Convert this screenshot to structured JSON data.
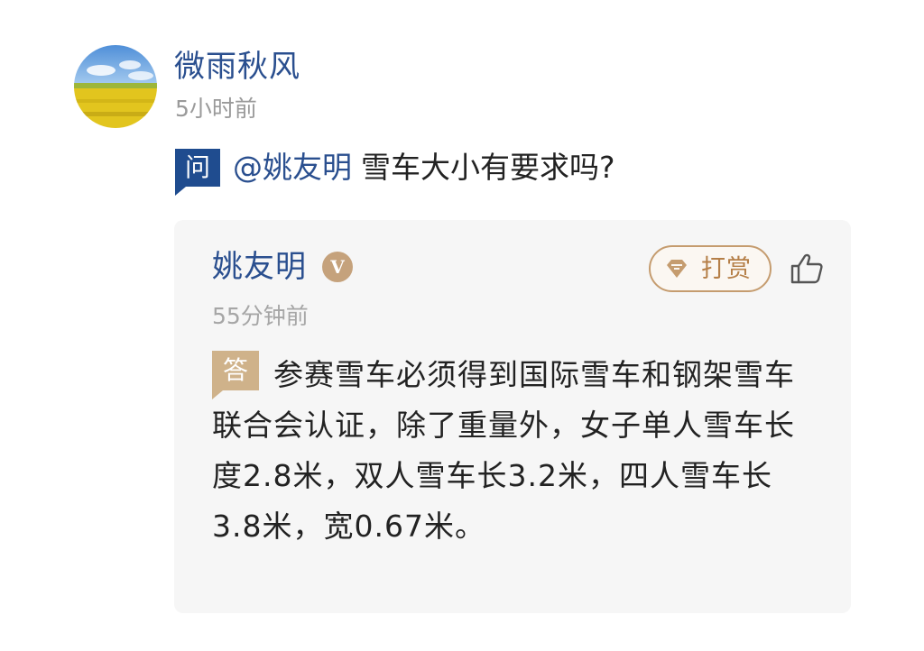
{
  "asker": {
    "name": "微雨秋风",
    "time": "5小时前",
    "avatar_icon": "avatar-rapeseed-field"
  },
  "question": {
    "badge": "问",
    "mention": "@姚友明",
    "text": "雪车大小有要求吗?"
  },
  "answer": {
    "answerer_name": "姚友明",
    "verified_badge": "V",
    "tip_label": "打赏",
    "tip_icon": "diamond-icon",
    "like_icon": "thumbs-up-icon",
    "time": "55分钟前",
    "badge": "答",
    "text": "参赛雪车必须得到国际雪车和钢架雪车联合会认证，除了重量外，女子单人雪车长度2.8米，双人雪车长3.2米，四人雪车长3.8米，宽0.67米。"
  },
  "colors": {
    "link_blue": "#2a4f8f",
    "question_badge": "#1f4c8f",
    "answer_badge": "#cfb28a",
    "tip_border": "#c59c6f",
    "card_bg": "#f6f6f6"
  }
}
